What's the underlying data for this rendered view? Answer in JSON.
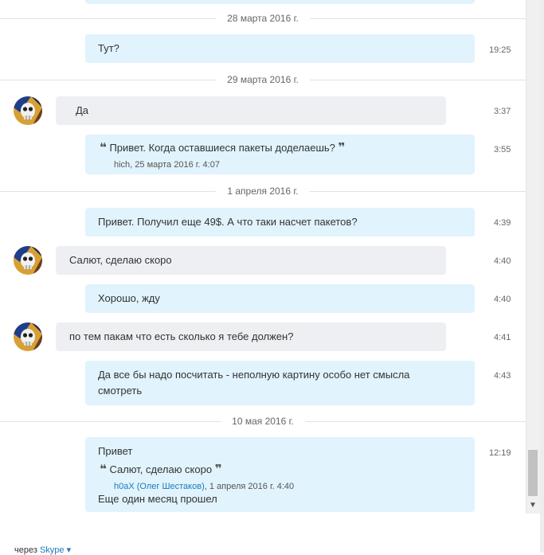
{
  "dates": {
    "d1": "28 марта 2016 г.",
    "d2": "29 марта 2016 г.",
    "d3": "1 апреля 2016 г.",
    "d4": "10 мая 2016 г."
  },
  "messages": [
    {
      "text": "Тут?",
      "time": "19:25"
    },
    {
      "text": "Да",
      "time": "3:37"
    },
    {
      "quote_text": "Привет. Когда оставшиеся пакеты доделаешь?",
      "quote_meta": "hich, 25 марта 2016 г. 4:07",
      "time": "3:55"
    },
    {
      "text": "Привет. Получил еще 49$. А что таки насчет пакетов?",
      "time": "4:39"
    },
    {
      "text": "Салют, сделаю скоро",
      "time": "4:40"
    },
    {
      "text": "Хорошо, жду",
      "time": "4:40"
    },
    {
      "text": "по тем пакам что есть сколько я тебе должен?",
      "time": "4:41"
    },
    {
      "text_line1": "Да все бы надо посчитать - неполную картину особо нет смысла",
      "text_line2": "смотреть",
      "time": "4:43"
    },
    {
      "text": "Привет",
      "quote_text": "Салют, сделаю скоро",
      "quote_author": "h0aX (Олег Шестаков)",
      "quote_meta": ", 1 апреля 2016 г. 4:40",
      "text_after": "Еще один месяц прошел",
      "time": "12:19"
    }
  ],
  "quote_open": "❝",
  "quote_close": "❞",
  "footer": {
    "via": "через",
    "link": "Skype",
    "caret": "▾"
  },
  "icons": {
    "avatar": "skull-avatar",
    "scroll_down": "chevron-down-icon"
  },
  "colors": {
    "own_bubble": "#e1f3fc",
    "other_bubble": "#eeeff3",
    "link": "#1a7bbd"
  }
}
